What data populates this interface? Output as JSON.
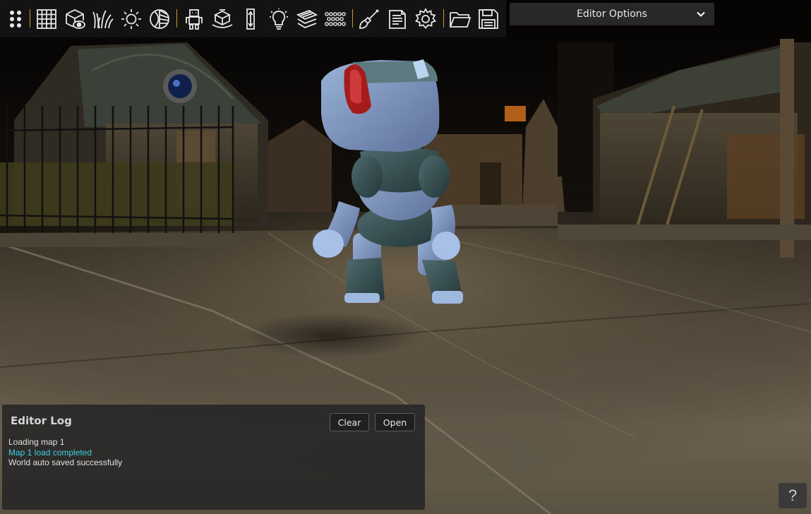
{
  "toolbar": {
    "buttons": [
      {
        "icon": "drag-handle-icon"
      },
      {
        "icon": "grid-icon"
      },
      {
        "icon": "view-object-icon"
      },
      {
        "icon": "grass-icon"
      },
      {
        "icon": "sun-icon"
      },
      {
        "icon": "sky-sphere-icon"
      },
      {
        "icon": "robot-icon"
      },
      {
        "icon": "terrain-block-icon"
      },
      {
        "icon": "height-icon"
      },
      {
        "icon": "light-bulb-icon"
      },
      {
        "icon": "layers-icon"
      },
      {
        "icon": "particles-icon"
      },
      {
        "icon": "paint-brush-icon"
      },
      {
        "icon": "script-icon"
      },
      {
        "icon": "settings-gear-icon"
      },
      {
        "icon": "open-folder-icon"
      },
      {
        "icon": "save-icon"
      }
    ],
    "accent_color": "#c49a2c"
  },
  "editor_options": {
    "label": "Editor Options"
  },
  "log": {
    "title": "Editor Log",
    "clear_label": "Clear",
    "open_label": "Open",
    "lines": [
      {
        "text": "Loading map 1",
        "color": "#e0e0e0"
      },
      {
        "text": "Map 1 load completed",
        "color": "#3fd0e0"
      },
      {
        "text": "World auto saved successfully",
        "color": "#e0e0e0"
      }
    ]
  },
  "help": {
    "label": "?"
  }
}
